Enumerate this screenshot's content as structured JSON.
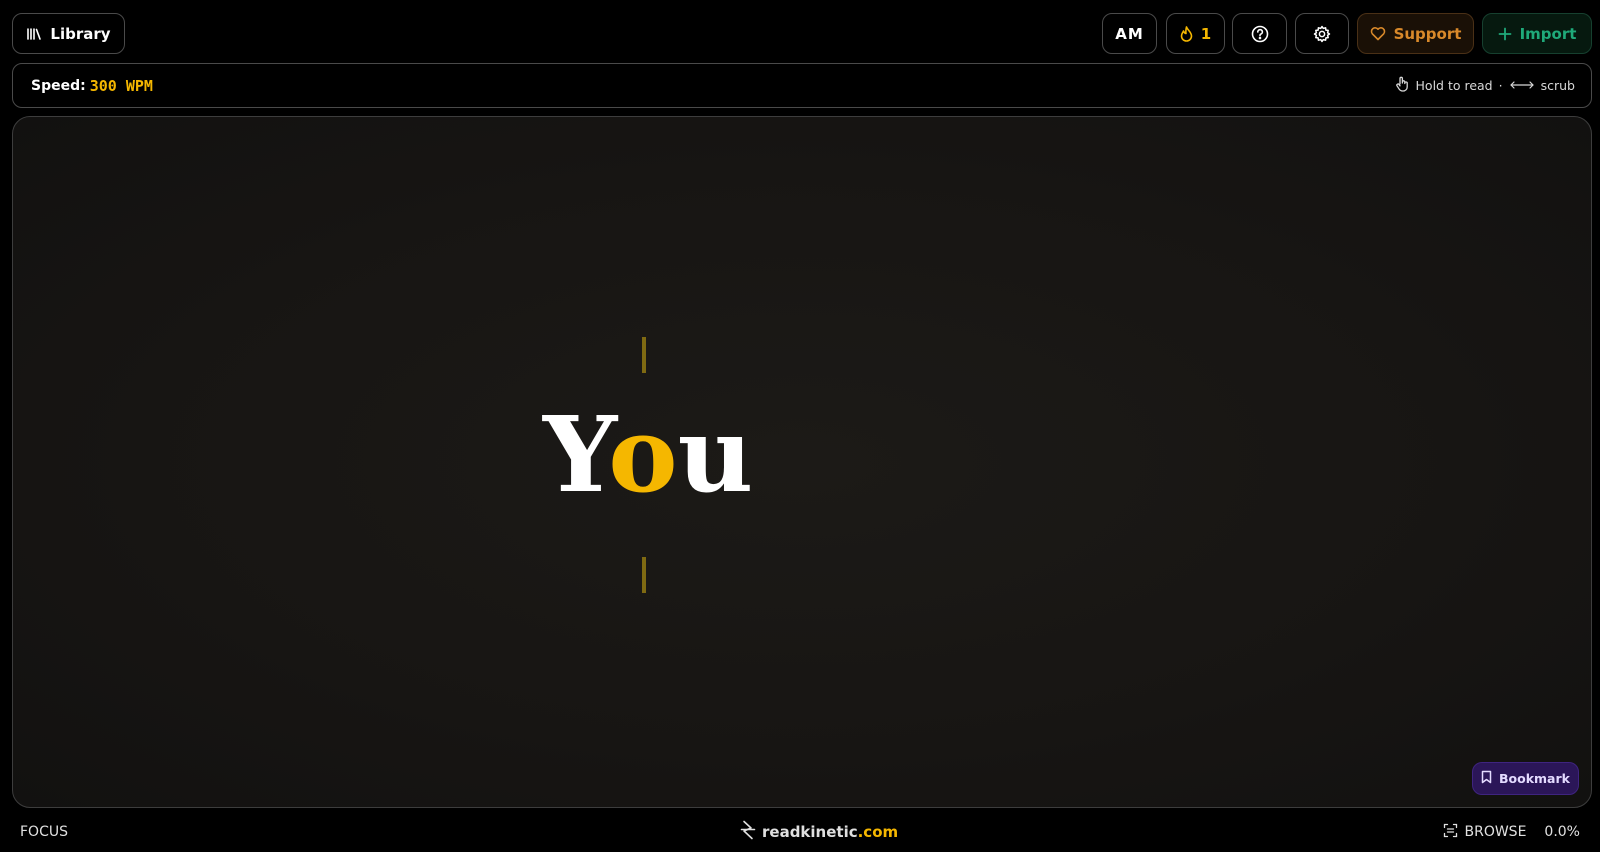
{
  "header": {
    "library_label": "Library",
    "initials": "AM",
    "streak_count": "1",
    "support_label": "Support",
    "import_label": "Import"
  },
  "speed_bar": {
    "label": "Speed:",
    "value": "300 WPM",
    "hint_hold": "Hold to read",
    "hint_sep": "·",
    "hint_scrub": "scrub"
  },
  "reader": {
    "word_before": "Y",
    "word_focus": "o",
    "word_after": "u",
    "bookmark_label": "Bookmark"
  },
  "footer": {
    "mode_label": "FOCUS",
    "brand_name": "readkinetic",
    "brand_tld": ".com",
    "browse_label": "BROWSE",
    "progress": "0.0%"
  },
  "colors": {
    "accent": "#f5b700",
    "support": "#d9892a",
    "import": "#1fa97a",
    "bookmark_bg": "#2b1658"
  },
  "icons": {
    "library": "library-books-icon",
    "streak": "flame-icon",
    "help": "help-circle-icon",
    "settings": "gear-icon",
    "support": "heart-icon",
    "import": "plus-icon",
    "hold": "hand-pointer-icon",
    "scrub": "double-arrow-icon",
    "bookmark": "bookmark-icon",
    "brand": "lightning-icon",
    "browse": "browse-icon"
  }
}
